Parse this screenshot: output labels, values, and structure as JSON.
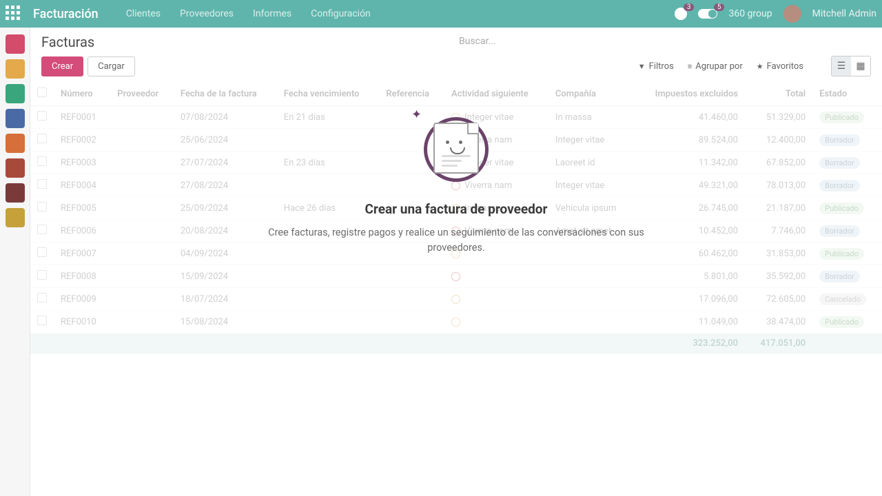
{
  "app": {
    "title": "Facturación"
  },
  "menu": [
    "Clientes",
    "Proveedores",
    "Informes",
    "Configuración"
  ],
  "topright": {
    "conv_badge": "3",
    "toggle_badge": "5",
    "company": "360 group",
    "user": "Mitchell Admin"
  },
  "breadcrumb": "Facturas",
  "search_placeholder": "Buscar...",
  "buttons": {
    "create": "Crear",
    "upload": "Cargar"
  },
  "filters": {
    "filters": "Filtros",
    "groupby": "Agrupar por",
    "favorites": "Favoritos"
  },
  "columns": {
    "number": "Número",
    "vendor": "Proveedor",
    "billdate": "Fecha de la factura",
    "duedate": "Fecha vencimiento",
    "reference": "Referencia",
    "activity": "Actividad siguiente",
    "company": "Compañía",
    "untaxed": "Impuestos excluidos",
    "total": "Total",
    "status": "Estado"
  },
  "status_labels": {
    "posted": "Publicado",
    "draft": "Borrador",
    "cancel": "Cancelado"
  },
  "rows": [
    {
      "n": "REF0001",
      "bd": "07/08/2024",
      "dd": "En 21 días",
      "act": "Integer vitae",
      "co": "In massa",
      "ut": "41.460,00",
      "t": "51.329,00",
      "s": "posted"
    },
    {
      "n": "REF0002",
      "bd": "25/06/2024",
      "dd": "",
      "act": "Viverra nam",
      "co": "Integer vitae",
      "ut": "89.524,00",
      "t": "12.400,00",
      "s": "draft"
    },
    {
      "n": "REF0003",
      "bd": "27/07/2024",
      "dd": "En 23 días",
      "act": "Integer vitae",
      "co": "Laoreet id",
      "ut": "11.342,00",
      "t": "67.852,00",
      "s": "draft"
    },
    {
      "n": "REF0004",
      "bd": "27/08/2024",
      "dd": "",
      "act": "Viverra nam",
      "co": "Integer vitae",
      "ut": "49.321,00",
      "t": "78.013,00",
      "s": "draft"
    },
    {
      "n": "REF0005",
      "bd": "25/09/2024",
      "dd": "Hace 26 días",
      "act": "In massa",
      "co": "Vehicula ipsum",
      "ut": "26.745,00",
      "t": "21.187,00",
      "s": "posted"
    },
    {
      "n": "REF0006",
      "bd": "20/08/2024",
      "dd": "",
      "act": "Viverra nam",
      "co": "Amet sit amet",
      "ut": "10.452,00",
      "t": "7.746,00",
      "s": "draft"
    },
    {
      "n": "REF0007",
      "bd": "04/09/2024",
      "dd": "",
      "act": "",
      "co": "",
      "ut": "60.462,00",
      "t": "31.853,00",
      "s": "posted"
    },
    {
      "n": "REF0008",
      "bd": "15/09/2024",
      "dd": "",
      "act": "",
      "co": "",
      "ut": "5.801,00",
      "t": "35.592,00",
      "s": "draft"
    },
    {
      "n": "REF0009",
      "bd": "18/07/2024",
      "dd": "",
      "act": "",
      "co": "",
      "ut": "17.096,00",
      "t": "72.605,00",
      "s": "cancel"
    },
    {
      "n": "REF0010",
      "bd": "15/08/2024",
      "dd": "",
      "act": "",
      "co": "",
      "ut": "11.049,00",
      "t": "38.474,00",
      "s": "posted"
    }
  ],
  "totals": {
    "untaxed": "323.252,00",
    "total": "417.051,00"
  },
  "overlay": {
    "title": "Crear una factura de proveedor",
    "subtitle": "Cree facturas, registre pagos y realice un seguimiento de las conversaciones con sus proveedores."
  }
}
